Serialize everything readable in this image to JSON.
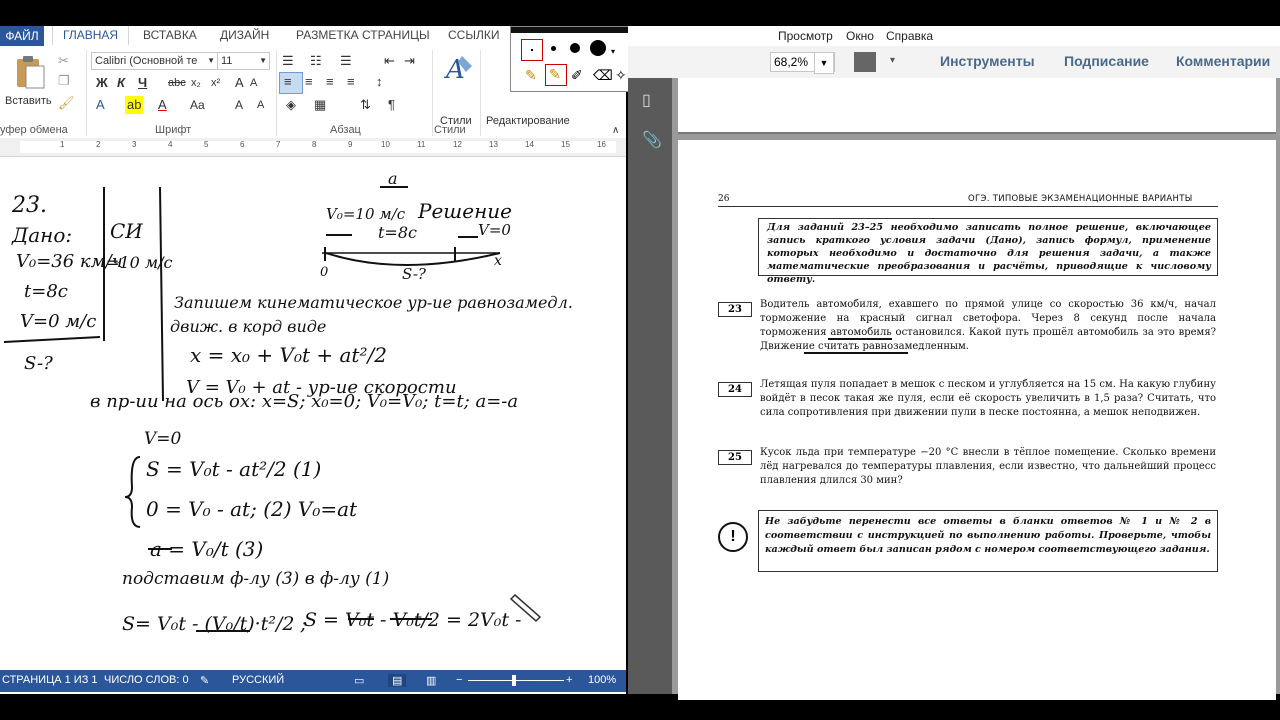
{
  "word": {
    "tabs": [
      "ФАЙЛ",
      "ГЛАВНАЯ",
      "ВСТАВКА",
      "ДИЗАЙН",
      "РАЗМЕТКА СТРАНИЦЫ",
      "ССЫЛКИ"
    ],
    "paste_label": "Вставить",
    "clipboard_label": "уфер обмена",
    "font_name": "Calibri (Основной те",
    "font_size": "11",
    "font_group_label": "Шрифт",
    "paragraph_group_label": "Абзац",
    "styles_button": "Стили",
    "styles_group_label": "Стили",
    "editing_label": "Редактирование",
    "ruler_ticks": [
      "1",
      "2",
      "3",
      "4",
      "5",
      "6",
      "7",
      "8",
      "9",
      "10",
      "11",
      "12",
      "13",
      "14",
      "15",
      "16"
    ],
    "handwriting": {
      "l1": "23.",
      "l2": "Дано:",
      "l3": "V₀=36 км/ч",
      "l4": "t=8с",
      "l5": "V=0 м/с",
      "l6": "S-?",
      "si": "СИ",
      "si_val": "=10 м/с",
      "solution": "Решение",
      "d_v0": "V₀=10 м/с",
      "d_t": "t=8с",
      "d_v": "V=0",
      "d_s": "S-?",
      "d_a": "a",
      "d_zero": "0",
      "d_x": "x",
      "e1": "Запишем кинематическое ур-ие равнозамедл.",
      "e2": "движ. в корд виде",
      "e3": "x = x₀ + V₀t + at²/2",
      "e4": "V = V₀ + at - ур-ие скорости",
      "e5": "в пр-ии на ось ox: x=S; x₀=0; V₀=V₀; t=t; a=-a",
      "e6": "V=0",
      "e7": "S = V₀t - at²/2 (1)",
      "e8": "0 = V₀ - at; (2) V₀=at",
      "e9": "a = V₀/t (3)",
      "e10": "подставим ф-лу (3) в ф-лу (1)",
      "e11": "S= V₀t - (V₀/t)·t²/2 ;",
      "e12": "S = V₀t - V₀t/2 = 2V₀t -"
    },
    "status": {
      "page": "СТРАНИЦА 1 ИЗ 1",
      "words": "ЧИСЛО СЛОВ: 0",
      "lang": "РУССКИЙ",
      "zoom": "100%"
    }
  },
  "pdf": {
    "menu": [
      "Просмотр",
      "Окно",
      "Справка"
    ],
    "zoom": "68,2%",
    "tools": "Инструменты",
    "sign": "Подписание",
    "comments": "Комментарии",
    "page_num": "26",
    "header": "ОГЭ. ТИПОВЫЕ ЭКЗАМЕНАЦИОННЫЕ ВАРИАНТЫ",
    "instruction": "Для заданий 23–25 необходимо записать полное решение, включающее запись краткого условия задачи (Дано), запись формул, применение которых необходимо и достаточно для решения задачи, а также математические преобразования и расчёты, приводящие к числовому ответу.",
    "q23_num": "23",
    "q23": "Водитель автомобиля, ехавшего по прямой улице со скоростью 36 км/ч, начал торможение на красный сигнал светофора. Через 8 секунд после начала торможения автомобиль остановился. Какой путь прошёл автомобиль за это время? Движение считать равнозамедленным.",
    "q24_num": "24",
    "q24": "Летящая пуля попадает в мешок с песком и углубляется на 15 см. На какую глубину войдёт в песок такая же пуля, если её скорость увеличить в 1,5 раза? Считать, что сила сопротивления при движении пули в песке постоянна, а мешок неподвижен.",
    "q25_num": "25",
    "q25": "Кусок льда при температуре −20 °С внесли в тёплое помещение. Сколько времени лёд нагревался до температуры плавления, если известно, что дальнейший процесс плавления длился 30 мин?",
    "reminder_mark": "!",
    "reminder": "Не забудьте перенести все ответы в бланки ответов № 1 и № 2 в соответствии с инструкцией по выполнению работы. Проверьте, чтобы каждый ответ был записан рядом с номером соответствующего задания."
  }
}
